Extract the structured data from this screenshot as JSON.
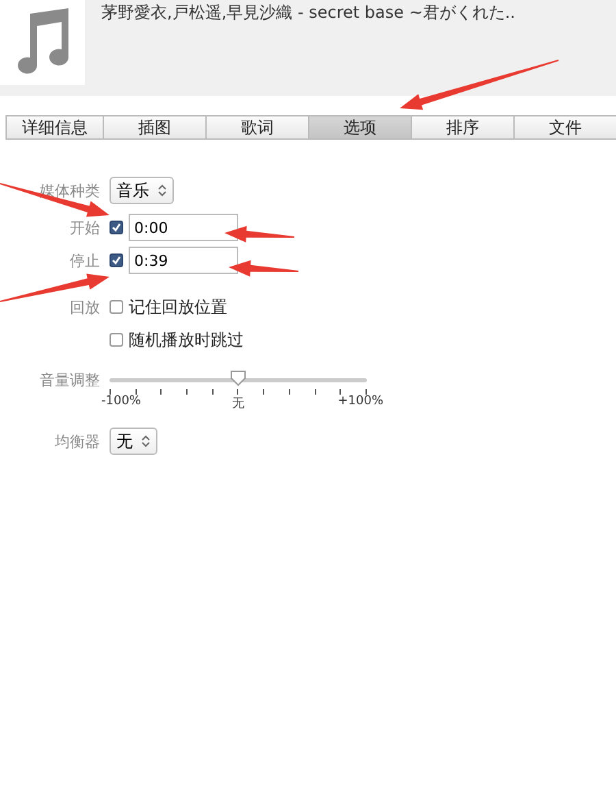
{
  "header": {
    "title": "茅野愛衣,戸松遥,早見沙織 - secret base ~君がくれた.."
  },
  "tabs": [
    {
      "label": "详细信息",
      "selected": false
    },
    {
      "label": "插图",
      "selected": false
    },
    {
      "label": "歌词",
      "selected": false
    },
    {
      "label": "选项",
      "selected": true
    },
    {
      "label": "排序",
      "selected": false
    },
    {
      "label": "文件",
      "selected": false
    }
  ],
  "media_kind": {
    "label": "媒体种类",
    "value": "音乐"
  },
  "start": {
    "label": "开始",
    "checked": true,
    "value": "0:00"
  },
  "stop": {
    "label": "停止",
    "checked": true,
    "value": "0:39"
  },
  "playback": {
    "label": "回放",
    "options": [
      {
        "label": "记住回放位置",
        "checked": false
      },
      {
        "label": "随机播放时跳过",
        "checked": false
      }
    ]
  },
  "volume": {
    "label": "音量调整",
    "level": 0.5,
    "min_label": "-100%",
    "mid_label": "无",
    "max_label": "+100%"
  },
  "equalizer": {
    "label": "均衡器",
    "value": "无"
  }
}
